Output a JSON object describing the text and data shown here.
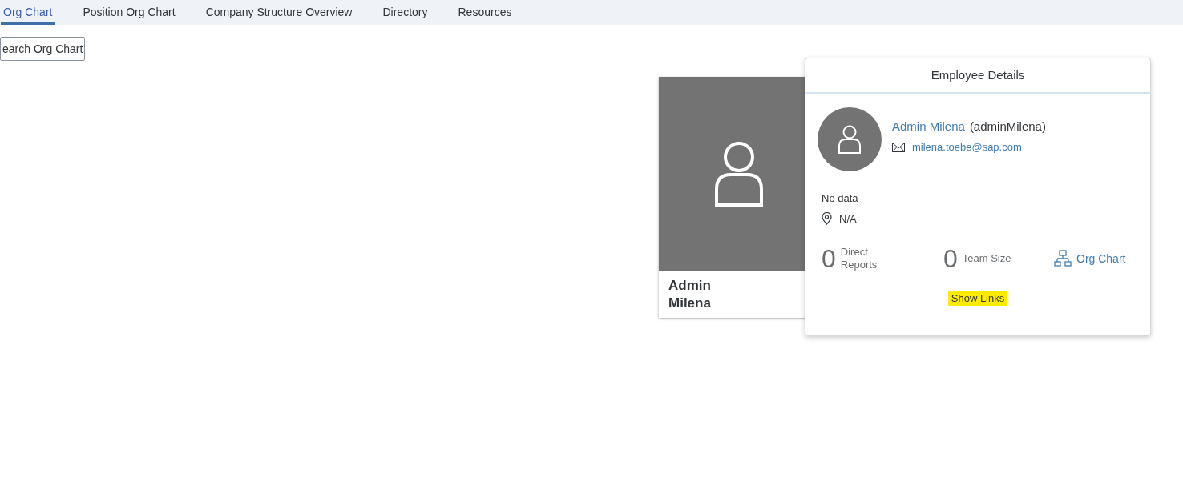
{
  "tabs": [
    {
      "label": "Org Chart",
      "selected": true
    },
    {
      "label": "Position Org Chart",
      "selected": false
    },
    {
      "label": "Company Structure Overview",
      "selected": false
    },
    {
      "label": "Directory",
      "selected": false
    },
    {
      "label": "Resources",
      "selected": false
    }
  ],
  "search_button": {
    "label": "earch Org Chart"
  },
  "card": {
    "name_line_1": "Admin",
    "name_line_2": "Milena"
  },
  "popover": {
    "title": "Employee Details",
    "name": "Admin Milena",
    "user_id": "(adminMilena)",
    "email": "milena.toebe@sap.com",
    "job": "No data",
    "location": "N/A",
    "stats": [
      {
        "count": "0",
        "label_line_1": "Direct",
        "label_line_2": "Reports"
      },
      {
        "count": "0",
        "label_line_1": "Team Size"
      }
    ],
    "org_chart_link": "Org Chart",
    "show_links": {
      "label": "Show Links",
      "highlighted": true
    }
  }
}
